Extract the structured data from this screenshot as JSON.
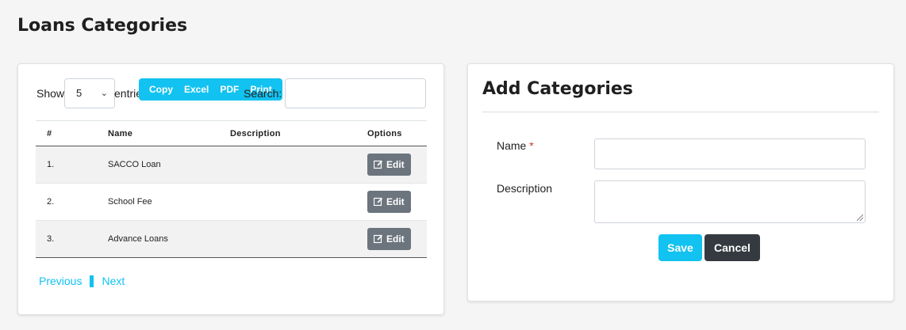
{
  "page": {
    "title": "Loans Categories"
  },
  "list": {
    "show_label": "Show",
    "entries_value": "5",
    "entries_label": "entries",
    "export_buttons": [
      "Copy",
      "Excel",
      "PDF",
      "Print"
    ],
    "search_label": "Search:",
    "search_value": "",
    "columns": [
      "#",
      "Name",
      "Description",
      "Options"
    ],
    "rows": [
      {
        "num": "1.",
        "name": "SACCO Loan",
        "description": "",
        "action": "Edit"
      },
      {
        "num": "2.",
        "name": "School Fee",
        "description": "",
        "action": "Edit"
      },
      {
        "num": "3.",
        "name": "Advance Loans",
        "description": "",
        "action": "Edit"
      }
    ],
    "pagination": {
      "previous": "Previous",
      "next": "Next"
    }
  },
  "form": {
    "title": "Add Categories",
    "name_label": "Name",
    "required_mark": "*",
    "description_label": "Description",
    "save_label": "Save",
    "cancel_label": "Cancel"
  },
  "colors": {
    "accent": "#12c2f0",
    "dark": "#343a40",
    "secondary": "#6c757d",
    "required": "#d9302c"
  }
}
